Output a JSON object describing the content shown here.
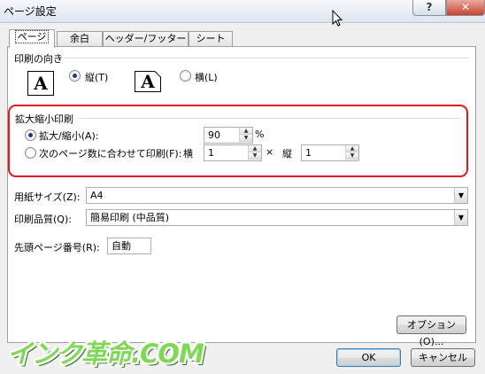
{
  "window": {
    "title": "ページ設定",
    "help_label": "?",
    "close_label": "✕"
  },
  "tabs": [
    {
      "label": "ページ"
    },
    {
      "label": "余白"
    },
    {
      "label": "ヘッダー/フッター"
    },
    {
      "label": "シート"
    }
  ],
  "orientation": {
    "title": "印刷の向き",
    "portrait_icon_letter": "A",
    "portrait_label": "縦(T)",
    "landscape_icon_letter": "A",
    "landscape_label": "横(L)",
    "selected": "portrait"
  },
  "scaling": {
    "title": "拡大縮小印刷",
    "adjust_label": "拡大/縮小(A):",
    "adjust_value": "90",
    "adjust_unit": "%",
    "fit_label": "次のページ数に合わせて印刷(F):",
    "wide_label": "横",
    "wide_value": "1",
    "times_symbol": "×",
    "tall_label": "縦",
    "tall_value": "1",
    "selected": "adjust",
    "highlight_color": "#e0191f"
  },
  "paper_size": {
    "label": "用紙サイズ(Z):",
    "value": "A4"
  },
  "print_quality": {
    "label": "印刷品質(Q):",
    "value": "簡易印刷 (中品質)"
  },
  "first_page": {
    "label": "先頭ページ番号(R):",
    "value": "自動"
  },
  "buttons": {
    "options": "オプション(O)...",
    "ok": "OK",
    "cancel": "キャンセル"
  },
  "watermark": {
    "text": "インク革命.COM"
  }
}
